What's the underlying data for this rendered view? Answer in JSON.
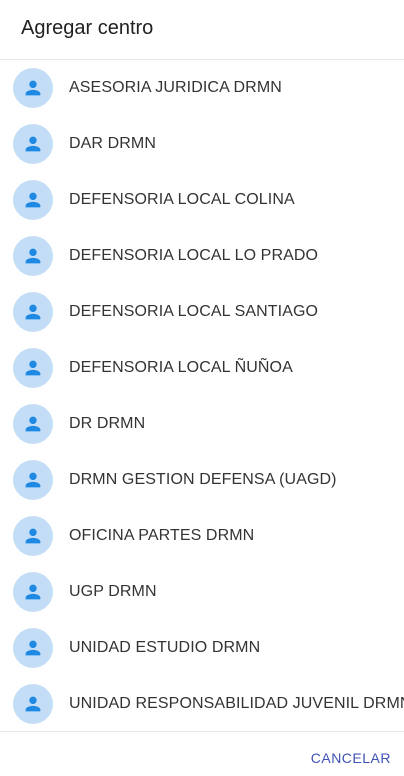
{
  "dialog": {
    "title": "Agregar centro",
    "cancel_label": "CANCELAR"
  },
  "colors": {
    "avatar_background": "#c3ddf6",
    "avatar_icon": "#1e88e5",
    "cancel_text": "#3f51b5"
  },
  "items": [
    {
      "label": "ASESORIA JURIDICA DRMN",
      "icon": "person-icon"
    },
    {
      "label": "DAR DRMN",
      "icon": "person-icon"
    },
    {
      "label": "DEFENSORIA LOCAL COLINA",
      "icon": "person-icon"
    },
    {
      "label": "DEFENSORIA LOCAL LO PRADO",
      "icon": "person-icon"
    },
    {
      "label": "DEFENSORIA LOCAL SANTIAGO",
      "icon": "person-icon"
    },
    {
      "label": "DEFENSORIA LOCAL ÑUÑOA",
      "icon": "person-icon"
    },
    {
      "label": "DR DRMN",
      "icon": "person-icon"
    },
    {
      "label": "DRMN GESTION DEFENSA (UAGD)",
      "icon": "person-icon"
    },
    {
      "label": "OFICINA PARTES DRMN",
      "icon": "person-icon"
    },
    {
      "label": "UGP DRMN",
      "icon": "person-icon"
    },
    {
      "label": "UNIDAD ESTUDIO DRMN",
      "icon": "person-icon"
    },
    {
      "label": "UNIDAD RESPONSABILIDAD JUVENIL DRMN",
      "icon": "person-icon"
    }
  ]
}
